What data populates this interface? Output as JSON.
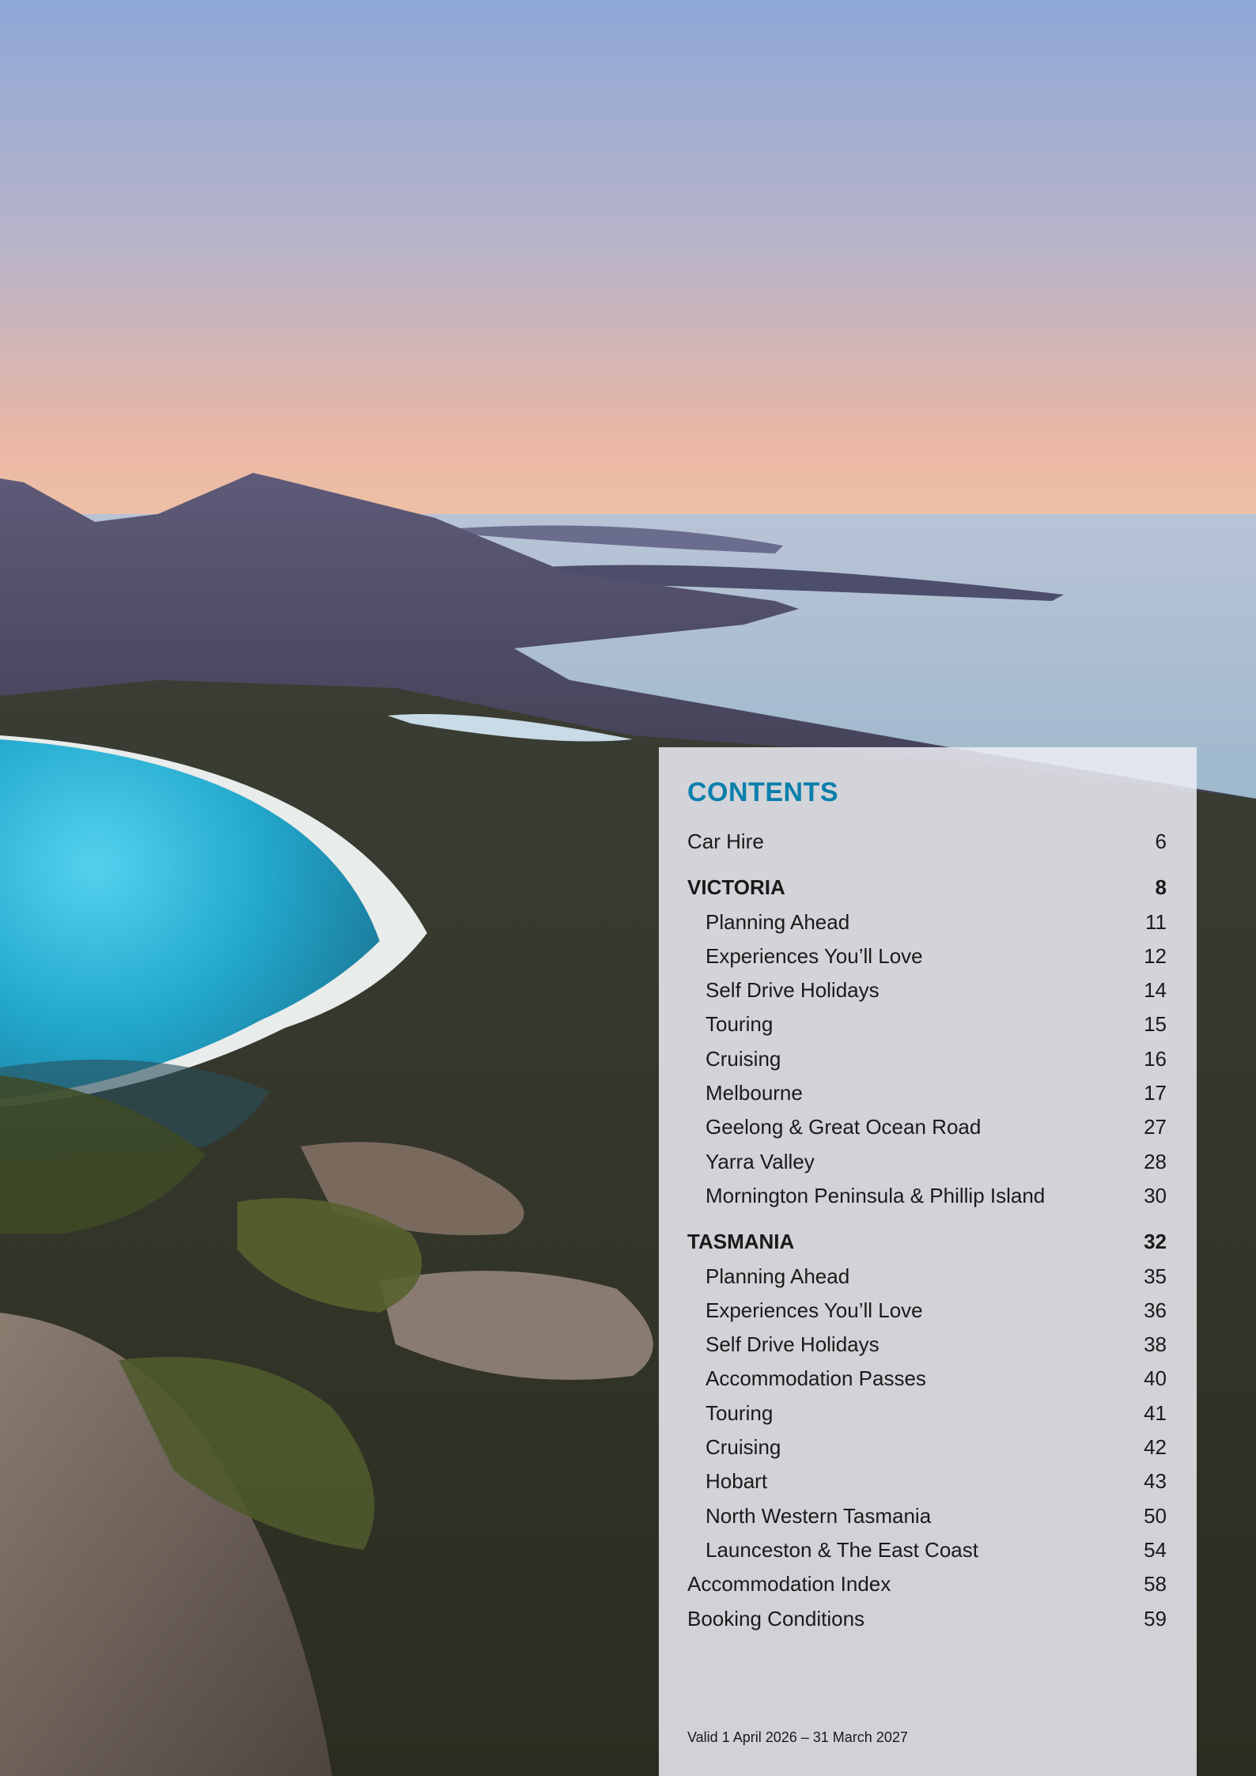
{
  "background": {
    "description_icon": "landscape-photo",
    "colors": {
      "sky_top": "#8ea8d8",
      "sky_glow": "#f0b7a0",
      "sea": "#a9c2d6",
      "bay": "#22b4d6",
      "forest": "#2f3a24",
      "rock": "#8a7a6e"
    }
  },
  "toc": {
    "heading": "CONTENTS",
    "heading_color": "#0a7fab",
    "entries": [
      {
        "title": "Car Hire",
        "page": "6",
        "kind": "top"
      },
      {
        "title": "VICTORIA",
        "page": "8",
        "kind": "section"
      },
      {
        "title": "Planning Ahead",
        "page": "11",
        "kind": "sub"
      },
      {
        "title": "Experiences You’ll Love",
        "page": "12",
        "kind": "sub"
      },
      {
        "title": "Self Drive Holidays",
        "page": "14",
        "kind": "sub"
      },
      {
        "title": "Touring",
        "page": "15",
        "kind": "sub"
      },
      {
        "title": "Cruising",
        "page": "16",
        "kind": "sub"
      },
      {
        "title": "Melbourne",
        "page": "17",
        "kind": "sub"
      },
      {
        "title": "Geelong & Great Ocean Road",
        "page": "27",
        "kind": "sub"
      },
      {
        "title": "Yarra Valley",
        "page": "28",
        "kind": "sub"
      },
      {
        "title": "Mornington Peninsula & Phillip Island",
        "page": "30",
        "kind": "sub"
      },
      {
        "title": "TASMANIA",
        "page": "32",
        "kind": "section"
      },
      {
        "title": "Planning Ahead",
        "page": "35",
        "kind": "sub"
      },
      {
        "title": "Experiences You’ll Love",
        "page": "36",
        "kind": "sub"
      },
      {
        "title": "Self Drive Holidays",
        "page": "38",
        "kind": "sub"
      },
      {
        "title": "Accommodation Passes",
        "page": "40",
        "kind": "sub"
      },
      {
        "title": "Touring",
        "page": "41",
        "kind": "sub"
      },
      {
        "title": "Cruising",
        "page": "42",
        "kind": "sub"
      },
      {
        "title": "Hobart",
        "page": "43",
        "kind": "sub"
      },
      {
        "title": "North Western Tasmania",
        "page": "50",
        "kind": "sub"
      },
      {
        "title": "Launceston & The East Coast",
        "page": "54",
        "kind": "sub"
      },
      {
        "title": "Accommodation Index",
        "page": "58",
        "kind": "top"
      },
      {
        "title": "Booking Conditions",
        "page": "59",
        "kind": "top"
      }
    ]
  },
  "footer": {
    "validity": "Valid 1 April 2026 – 31 March 2027"
  }
}
